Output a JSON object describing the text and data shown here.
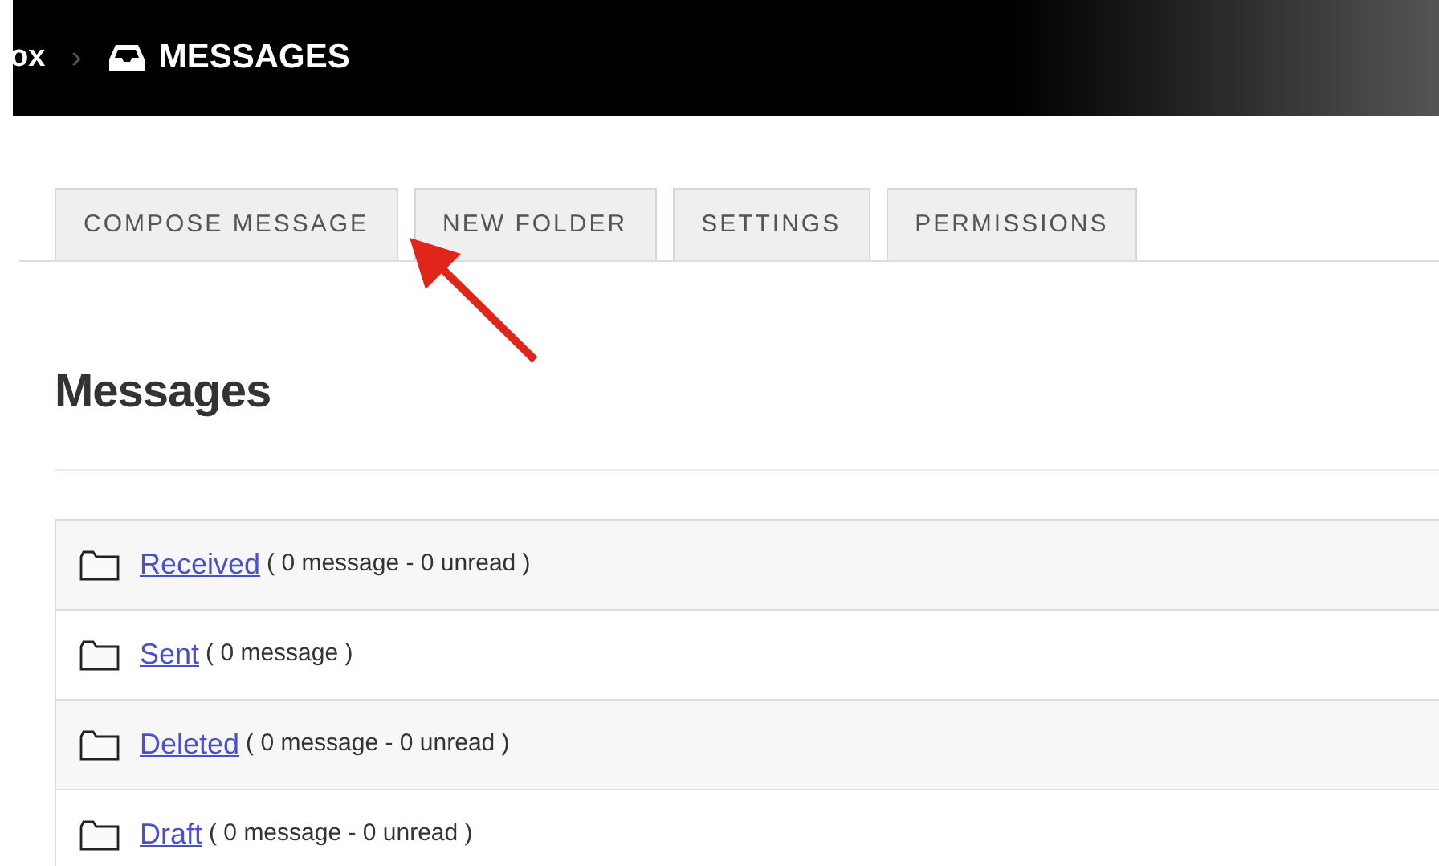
{
  "breadcrumb": {
    "parent": "ox",
    "separator": "›",
    "current": "MESSAGES"
  },
  "tabs": [
    {
      "label": "COMPOSE MESSAGE"
    },
    {
      "label": "NEW FOLDER"
    },
    {
      "label": "SETTINGS"
    },
    {
      "label": "PERMISSIONS"
    }
  ],
  "heading": "Messages",
  "folders": [
    {
      "name": "Received",
      "info": "( 0 message - 0 unread )"
    },
    {
      "name": "Sent",
      "info": "( 0 message )"
    },
    {
      "name": "Deleted",
      "info": "( 0 message - 0 unread )"
    },
    {
      "name": "Draft",
      "info": "( 0 message - 0 unread )"
    }
  ]
}
